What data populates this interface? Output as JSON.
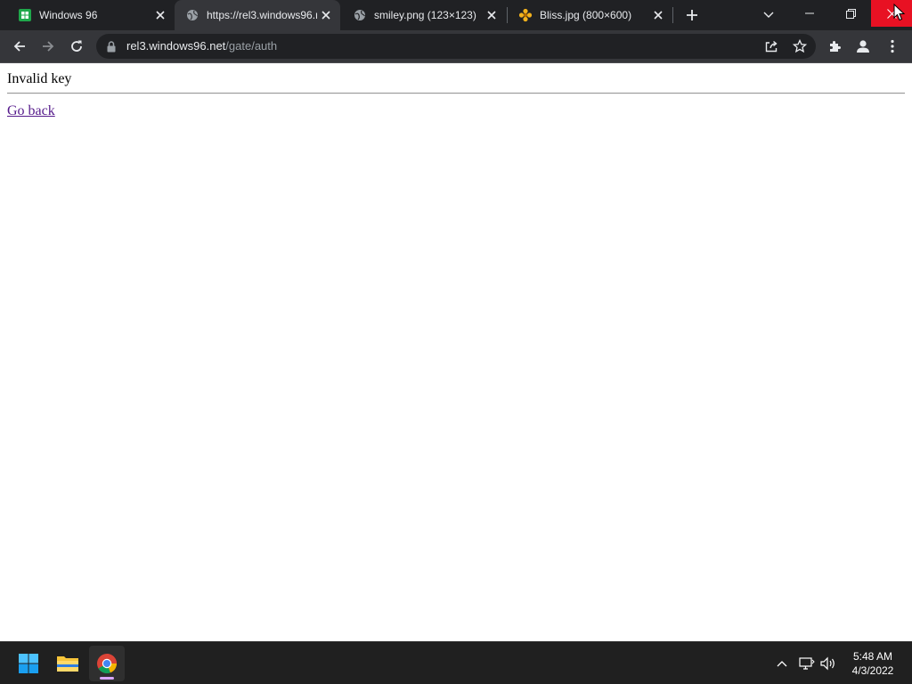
{
  "browser": {
    "tabs": [
      {
        "title": "Windows 96",
        "favicon": "windows96-icon",
        "active": false
      },
      {
        "title": "https://rel3.windows96.net/gate/auth",
        "favicon": "globe-icon",
        "active": true
      },
      {
        "title": "smiley.png (123×123)",
        "favicon": "globe-icon",
        "active": false
      },
      {
        "title": "Bliss.jpg (800×600)",
        "favicon": "flower-icon",
        "active": false
      }
    ],
    "address": {
      "host": "rel3.windows96.net",
      "path": "/gate/auth"
    },
    "colors": {
      "close_hover": "#e81123",
      "frame": "#202124",
      "toolbar": "#35363a"
    }
  },
  "page": {
    "message": "Invalid key",
    "back_link": "Go back",
    "link_color": "#551a8b"
  },
  "taskbar": {
    "apps": [
      "start-icon",
      "file-explorer-icon",
      "chrome-icon"
    ],
    "tray": [
      "chevron-up-icon",
      "network-icon",
      "volume-icon"
    ],
    "time": "5:48 AM",
    "date": "4/3/2022"
  }
}
